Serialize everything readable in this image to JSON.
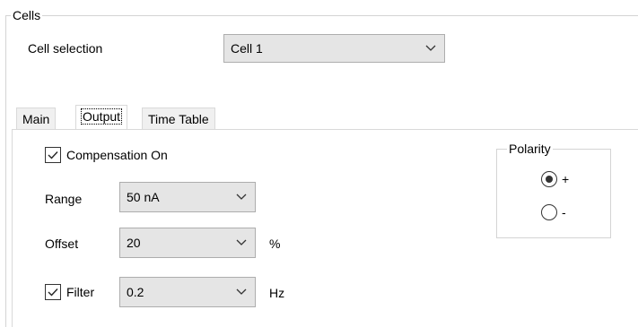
{
  "cells_group": {
    "title": "Cells",
    "cell_selection_label": "Cell selection",
    "cell_selection_value": "Cell 1"
  },
  "tabs": [
    {
      "label": "Main",
      "active": false
    },
    {
      "label": "Output",
      "active": true
    },
    {
      "label": "Time Table",
      "active": false
    }
  ],
  "output": {
    "compensation": {
      "label": "Compensation On",
      "checked": true
    },
    "range": {
      "label": "Range",
      "value": "50 nA"
    },
    "offset": {
      "label": "Offset",
      "value": "20",
      "unit": "%"
    },
    "filter": {
      "label": "Filter",
      "checked": true,
      "value": "0.2",
      "unit": "Hz"
    }
  },
  "polarity": {
    "title": "Polarity",
    "options": [
      {
        "label": "+",
        "selected": true
      },
      {
        "label": "-",
        "selected": false
      }
    ]
  },
  "icons": {
    "chevron": "chevron-down-icon",
    "check": "checkmark-icon"
  }
}
